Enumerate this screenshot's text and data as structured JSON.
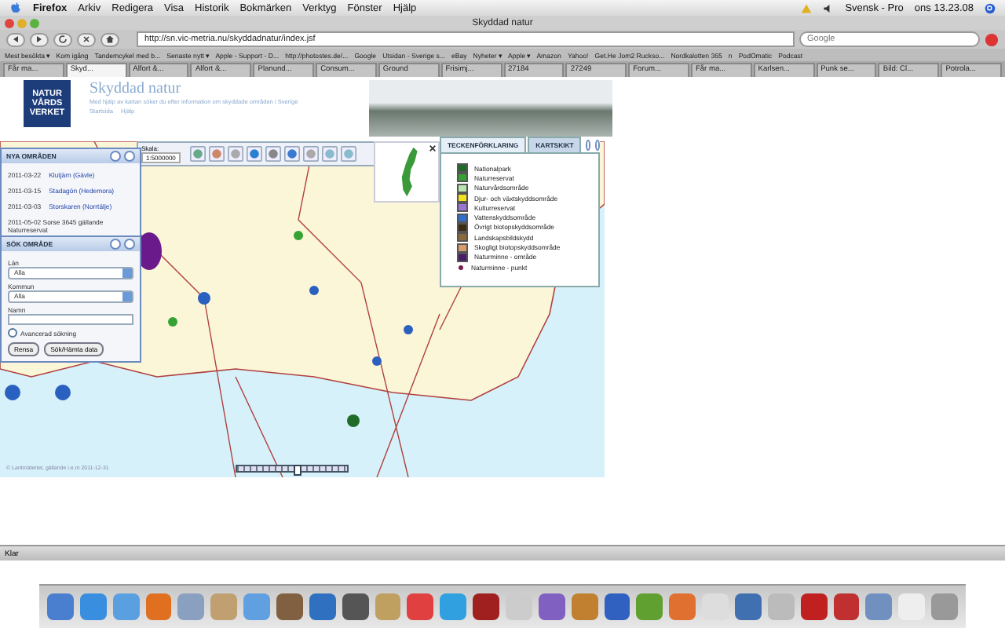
{
  "menu_bar": {
    "app": "Firefox",
    "items": [
      "Arkiv",
      "Redigera",
      "Visa",
      "Historik",
      "Bokmärken",
      "Verktyg",
      "Fönster",
      "Hjälp"
    ],
    "input_source": "Svensk - Pro",
    "clock": "ons 13.23.08"
  },
  "window": {
    "title": "Skyddad natur"
  },
  "toolbar": {
    "url": "http://sn.vic-metria.nu/skyddadnatur/index.jsf",
    "search": {
      "placeholder": "Google"
    }
  },
  "bookmarks": [
    "Mest besökta ▾",
    "Kom igång",
    "Tandemcykel med b...",
    "Senaste nytt ▾",
    "Apple - Support - D...",
    "http://photostes.de/...",
    "Google",
    "Utsidan - Sverige s...",
    "eBay",
    "Nyheter ▾",
    "Apple ▾",
    "Amazon",
    "Yahoo!",
    "Get.He Jom2 Ruckso...",
    "Nordkalotten 365",
    "n",
    "PodOmatic",
    "Podcast"
  ],
  "tabs": [
    {
      "label": "Får ma...",
      "selected": false
    },
    {
      "label": "Skyd...",
      "selected": true
    },
    {
      "label": "Alfort &...",
      "selected": false
    },
    {
      "label": "Alfort &...",
      "selected": false
    },
    {
      "label": "Planund...",
      "selected": false
    },
    {
      "label": "Consum...",
      "selected": false
    },
    {
      "label": "Ground",
      "selected": false
    },
    {
      "label": "Frisimj...",
      "selected": false
    },
    {
      "label": "27184",
      "selected": false
    },
    {
      "label": "27249",
      "selected": false
    },
    {
      "label": "Forum...",
      "selected": false
    },
    {
      "label": "Får ma...",
      "selected": false
    },
    {
      "label": "Karlsen...",
      "selected": false
    },
    {
      "label": "Punk se...",
      "selected": false
    },
    {
      "label": "Bild: Cl...",
      "selected": false
    },
    {
      "label": "Potrola...",
      "selected": false
    }
  ],
  "page": {
    "logo": [
      "NATUR",
      "VÅRDS",
      "VERKET"
    ],
    "title": "Skyddad natur",
    "subtitle": "Med hjälp av kartan söker du efter information om skyddade områden i Sverige",
    "links": [
      "Startsida",
      "Hjälp"
    ]
  },
  "map": {
    "scale_label": "Skala:",
    "scale": "1:5000000",
    "copyright": "© Lantmäteriet, gällande i.e.m 2011-12-31",
    "zoom": {
      "level": 0.54
    }
  },
  "new_areas": {
    "title": "NYA OMRÅDEN",
    "items": [
      {
        "date": "2011-03-22",
        "name": "Klutjärn (Gävle)"
      },
      {
        "date": "2011-03-15",
        "name": "Stadagön (Hedemora)"
      },
      {
        "date": "2011-03-03",
        "name": "Storskaren (Norrtälje)"
      }
    ],
    "note": "2011-05-02 Sorse 3645 gällande Naturreservat"
  },
  "search_area": {
    "title": "SÖK OMRÅDE",
    "fields": [
      {
        "label": "Län",
        "value": "Alla",
        "kind": "select"
      },
      {
        "label": "Kommun",
        "value": "Alla",
        "kind": "select"
      },
      {
        "label": "Namn",
        "kind": "text"
      }
    ],
    "advanced": {
      "label": "Avancerad sökning",
      "checked": false
    },
    "buttons": [
      "Rensa",
      "Sök/Hämta data"
    ]
  },
  "legend": {
    "tabs": [
      {
        "label": "TECKENFÖRKLARING",
        "selected": true
      },
      {
        "label": "KARTSKIKT",
        "selected": false
      }
    ],
    "items": [
      {
        "label": "Nationalpark",
        "color": "#1f6b2a",
        "kind": "square"
      },
      {
        "label": "Naturreservat",
        "color": "#35a332",
        "kind": "square"
      },
      {
        "label": "Naturvårdsområde",
        "color": "#b9e6ae",
        "kind": "square"
      },
      {
        "label": "Djur- och växtskyddsområde",
        "color": "#f2e21c",
        "kind": "square"
      },
      {
        "label": "Kulturreservat",
        "color": "#9c74d4",
        "kind": "square"
      },
      {
        "label": "Vattenskyddsområde",
        "color": "#2e6fd0",
        "kind": "square"
      },
      {
        "label": "Övrigt biotopskyddsområde",
        "color": "#3b2c12",
        "kind": "square"
      },
      {
        "label": "Landskapsbildskydd",
        "color": "#8c6a38",
        "kind": "square"
      },
      {
        "label": "Skogligt biotopskyddsområde",
        "color": "#d99c6c",
        "kind": "square"
      },
      {
        "label": "Naturminne - område",
        "color": "#4b1c6b",
        "kind": "square"
      },
      {
        "label": "Naturminne - punkt",
        "color": "#7a1c4c",
        "kind": "dot"
      }
    ]
  },
  "status_bar": {
    "text": "Klar"
  }
}
